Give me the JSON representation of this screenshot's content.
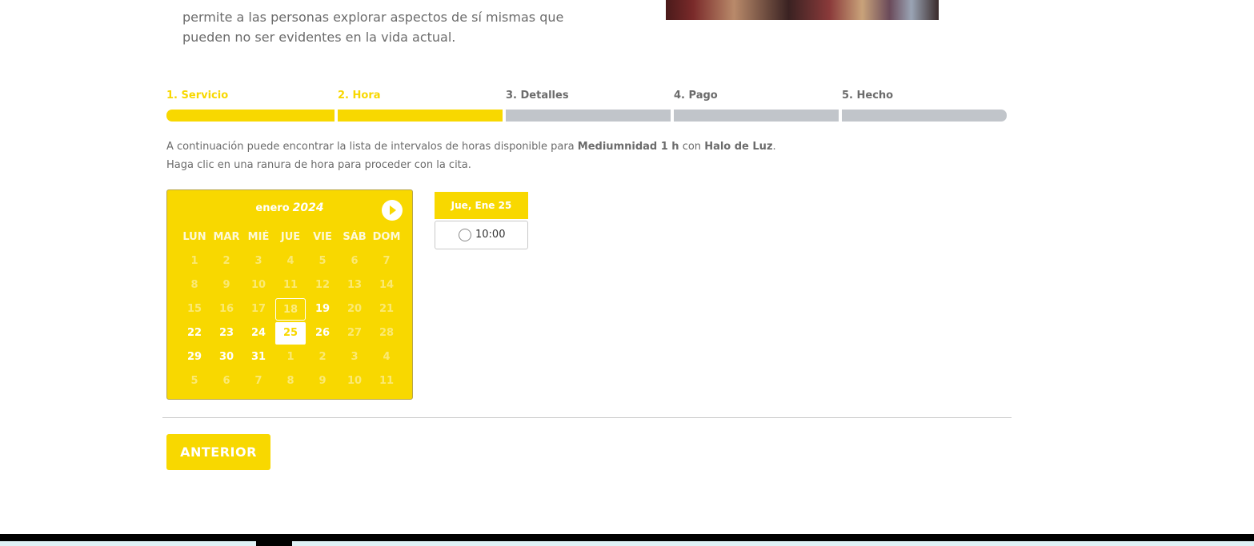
{
  "intro": {
    "lines": [
      "permite a las personas explorar aspectos de sí mismas que",
      "pueden no ser evidentes en la vida actual."
    ]
  },
  "steps": [
    {
      "label": "1. Servicio",
      "active": true
    },
    {
      "label": "2. Hora",
      "active": true
    },
    {
      "label": "3. Detalles",
      "active": false
    },
    {
      "label": "4. Pago",
      "active": false
    },
    {
      "label": "5. Hecho",
      "active": false
    }
  ],
  "info": {
    "line1_prefix": "A continuación puede encontrar la lista de intervalos de horas disponible para",
    "service": "Mediumnidad 1 h",
    "connector": "con",
    "staff": "Halo de Luz",
    "suffix": ".",
    "line2": "Haga clic en una ranura de hora para proceder con la cita."
  },
  "calendar": {
    "month": "enero",
    "year": "2024",
    "weekdays": [
      "LUN",
      "MAR",
      "MIÉ",
      "JUE",
      "VIE",
      "SÁB",
      "DOM"
    ],
    "weeks": [
      [
        {
          "d": "1",
          "s": "dim"
        },
        {
          "d": "2",
          "s": "dim"
        },
        {
          "d": "3",
          "s": "dim"
        },
        {
          "d": "4",
          "s": "dim"
        },
        {
          "d": "5",
          "s": "dim"
        },
        {
          "d": "6",
          "s": "dim"
        },
        {
          "d": "7",
          "s": "dim"
        }
      ],
      [
        {
          "d": "8",
          "s": "dim"
        },
        {
          "d": "9",
          "s": "dim"
        },
        {
          "d": "10",
          "s": "dim"
        },
        {
          "d": "11",
          "s": "dim"
        },
        {
          "d": "12",
          "s": "dim"
        },
        {
          "d": "13",
          "s": "dim"
        },
        {
          "d": "14",
          "s": "dim"
        }
      ],
      [
        {
          "d": "15",
          "s": "dim"
        },
        {
          "d": "16",
          "s": "dim"
        },
        {
          "d": "17",
          "s": "dim"
        },
        {
          "d": "18",
          "s": "today"
        },
        {
          "d": "19",
          "s": "avail"
        },
        {
          "d": "20",
          "s": "dim"
        },
        {
          "d": "21",
          "s": "dim"
        }
      ],
      [
        {
          "d": "22",
          "s": "avail"
        },
        {
          "d": "23",
          "s": "avail"
        },
        {
          "d": "24",
          "s": "avail"
        },
        {
          "d": "25",
          "s": "sel"
        },
        {
          "d": "26",
          "s": "avail"
        },
        {
          "d": "27",
          "s": "dim"
        },
        {
          "d": "28",
          "s": "dim"
        }
      ],
      [
        {
          "d": "29",
          "s": "avail"
        },
        {
          "d": "30",
          "s": "avail"
        },
        {
          "d": "31",
          "s": "avail"
        },
        {
          "d": "1",
          "s": "dim"
        },
        {
          "d": "2",
          "s": "dim"
        },
        {
          "d": "3",
          "s": "dim"
        },
        {
          "d": "4",
          "s": "dim"
        }
      ],
      [
        {
          "d": "5",
          "s": "dim"
        },
        {
          "d": "6",
          "s": "dim"
        },
        {
          "d": "7",
          "s": "dim"
        },
        {
          "d": "8",
          "s": "dim"
        },
        {
          "d": "9",
          "s": "dim"
        },
        {
          "d": "10",
          "s": "dim"
        },
        {
          "d": "11",
          "s": "dim"
        }
      ]
    ]
  },
  "slots": {
    "date_label": "Jue, Ene 25",
    "times": [
      "10:00"
    ]
  },
  "buttons": {
    "previous": "ANTERIOR"
  },
  "colors": {
    "accent": "#f8d800",
    "inactive": "#c1c5ca",
    "text": "#6b6b6b"
  }
}
